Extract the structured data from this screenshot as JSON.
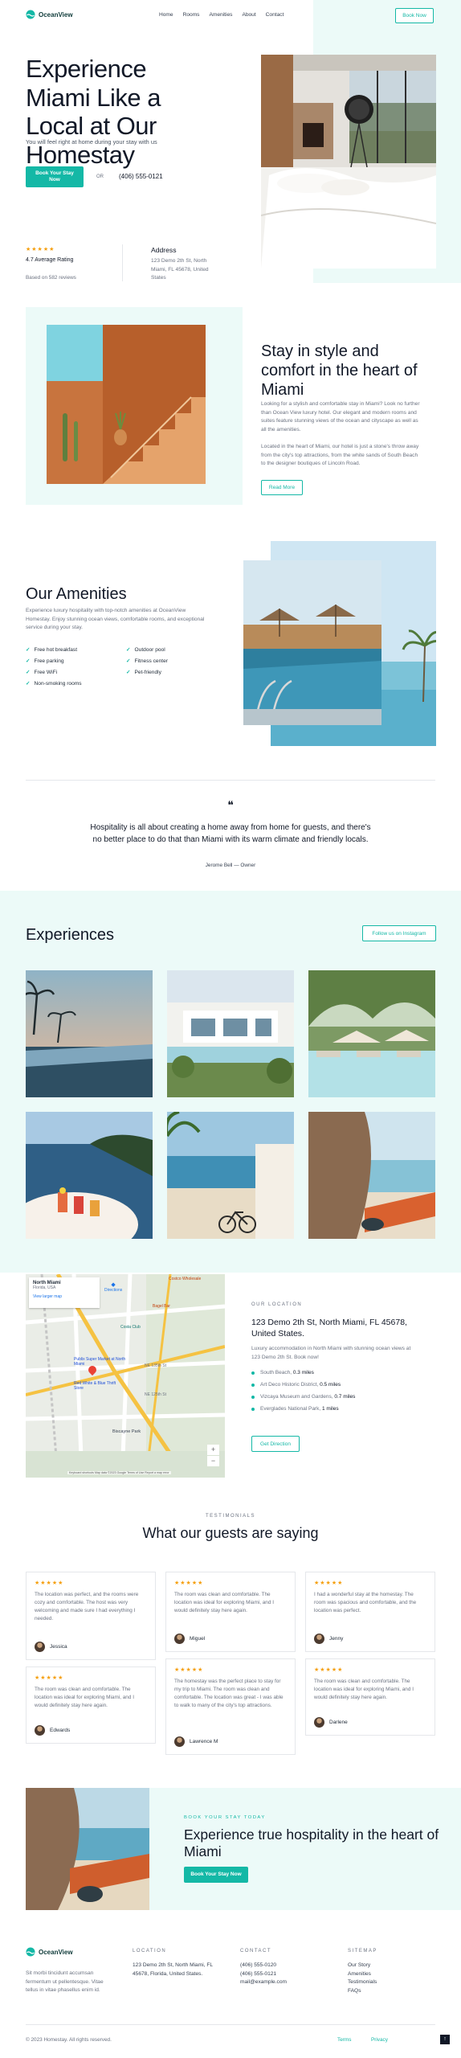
{
  "brand": {
    "name": "OceanView"
  },
  "nav": {
    "links": [
      "Home",
      "Rooms",
      "Amenities",
      "About",
      "Contact"
    ],
    "cta": "Book Now"
  },
  "hero": {
    "title": "Experience Miami Like a Local at Our Homestay",
    "subtitle": "You will feel right at home during your stay with us",
    "cta": "Book Your Stay Now",
    "or": "OR",
    "phone": "(406) 555-0121",
    "rating_stars": "★★★★★",
    "rating_label": "4.7 Average Rating",
    "rating_sub": "Based on 582 reviews",
    "address_label": "Address",
    "address": "123 Demo 2th St, North Miami, FL 45678, United States"
  },
  "style": {
    "title": "Stay in style and comfort in the heart of Miami",
    "p1": "Looking for a stylish and comfortable stay in Miami? Look no further than Ocean View luxury hotel. Our elegant and modern rooms and suites feature stunning views of the ocean and cityscape as well as all the amenities.",
    "p2": "Located in the heart of Miami, our hotel is just a stone's throw away from the city's top attractions, from the white sands of South Beach to the designer boutiques of Lincoln Road.",
    "cta": "Read More"
  },
  "amenities": {
    "title": "Our Amenities",
    "desc": "Experience luxury hospitality with top-notch amenities at OceanView Homestay. Enjoy stunning ocean views, comfortable rooms, and exceptional service during your stay.",
    "left": [
      "Free hot breakfast",
      "Free parking",
      "Free WiFi",
      "Non-smoking rooms"
    ],
    "right": [
      "Outdoor pool",
      "Fitness center",
      "Pet-friendly"
    ]
  },
  "quote": {
    "mark": "❝",
    "text": "Hospitality is all about creating a home away from home for guests, and there's no better place to do that than Miami with its warm climate and friendly locals.",
    "author": "Jerome Bell — Owner"
  },
  "experiences": {
    "title": "Experiences",
    "cta": "Follow us on Instagram"
  },
  "map": {
    "place": "North Miami",
    "place_sub": "Florida, USA",
    "directions": "Directions",
    "view_larger": "View larger map",
    "labels": [
      "Bagel Bar",
      "Costa Club",
      "Publix Super Market at North Miami",
      "Red White & Blue Thrift Store",
      "Biscayne Park",
      "NE 125th St",
      "NE 135th St",
      "Costco Wholesale"
    ],
    "zoom_in": "+",
    "zoom_out": "−",
    "footer": "Keyboard shortcuts   Map data ©2023 Google   Terms of Use   Report a map error"
  },
  "location": {
    "eyebrow": "OUR LOCATION",
    "title": "123 Demo 2th St, North Miami, FL 45678, United States.",
    "desc": "Luxury accommodation in North Miami with stunning ocean views at 123 Demo 2th St. Book now!",
    "places": [
      {
        "name": "South Beach",
        "dist": "0.3 miles"
      },
      {
        "name": "Art Deco Historic District",
        "dist": "0.5 miles"
      },
      {
        "name": "Vizcaya Museum and Gardens",
        "dist": "0.7 miles"
      },
      {
        "name": "Everglades National Park",
        "dist": "1 miles"
      }
    ],
    "cta": "Get Direction"
  },
  "testimonials": {
    "eyebrow": "TESTIMONIALS",
    "title": "What our guests are saying",
    "items": [
      {
        "stars": "★★★★★",
        "text": "The location was perfect, and the rooms were cozy and comfortable. The host was very welcoming and made sure I had everything I needed.",
        "name": "Jessica"
      },
      {
        "stars": "★★★★★",
        "text": "The room was clean and comfortable. The location was ideal for exploring Miami, and I would definitely stay here again.",
        "name": "Miguel"
      },
      {
        "stars": "★★★★★",
        "text": "I had a wonderful stay at the homestay. The room was spacious and comfortable, and the location was perfect.",
        "name": "Jenny"
      },
      {
        "stars": "★★★★★",
        "text": "The room was clean and comfortable. The location was ideal for exploring Miami, and I would definitely stay here again.",
        "name": "Edwards"
      },
      {
        "stars": "★★★★★",
        "text": "The homestay was the perfect place to stay for my trip to Miami. The room was clean and comfortable. The location was great - I was able to walk to many of the city's top attractions.",
        "name": "Lawrence M"
      },
      {
        "stars": "★★★★★",
        "text": "The room was clean and comfortable. The location was ideal for exploring Miami, and I would definitely stay here again.",
        "name": "Darlene"
      }
    ]
  },
  "cta": {
    "eyebrow": "BOOK YOUR STAY TODAY",
    "title": "Experience true hospitality in the heart of Miami",
    "button": "Book Your Stay Now"
  },
  "footer": {
    "desc": "Sit morbi tincidunt accumsan fermentum ut pellentesque. Vitae tellus in vitae phasellus enim id.",
    "location_h": "LOCATION",
    "location": "123 Demo 2th St, North Miami, FL 45678, Florida, United States.",
    "contact_h": "CONTACT",
    "contact": [
      "(406) 555-0120",
      "(406) 555-0121",
      "mail@example.com"
    ],
    "sitemap_h": "SITEMAP",
    "sitemap": [
      "Our Story",
      "Amenities",
      "Testimonials",
      "FAQs"
    ],
    "copyright": "© 2023 Homestay. All rights reserved.",
    "terms": "Terms",
    "privacy": "Privacy",
    "up": "↑"
  }
}
